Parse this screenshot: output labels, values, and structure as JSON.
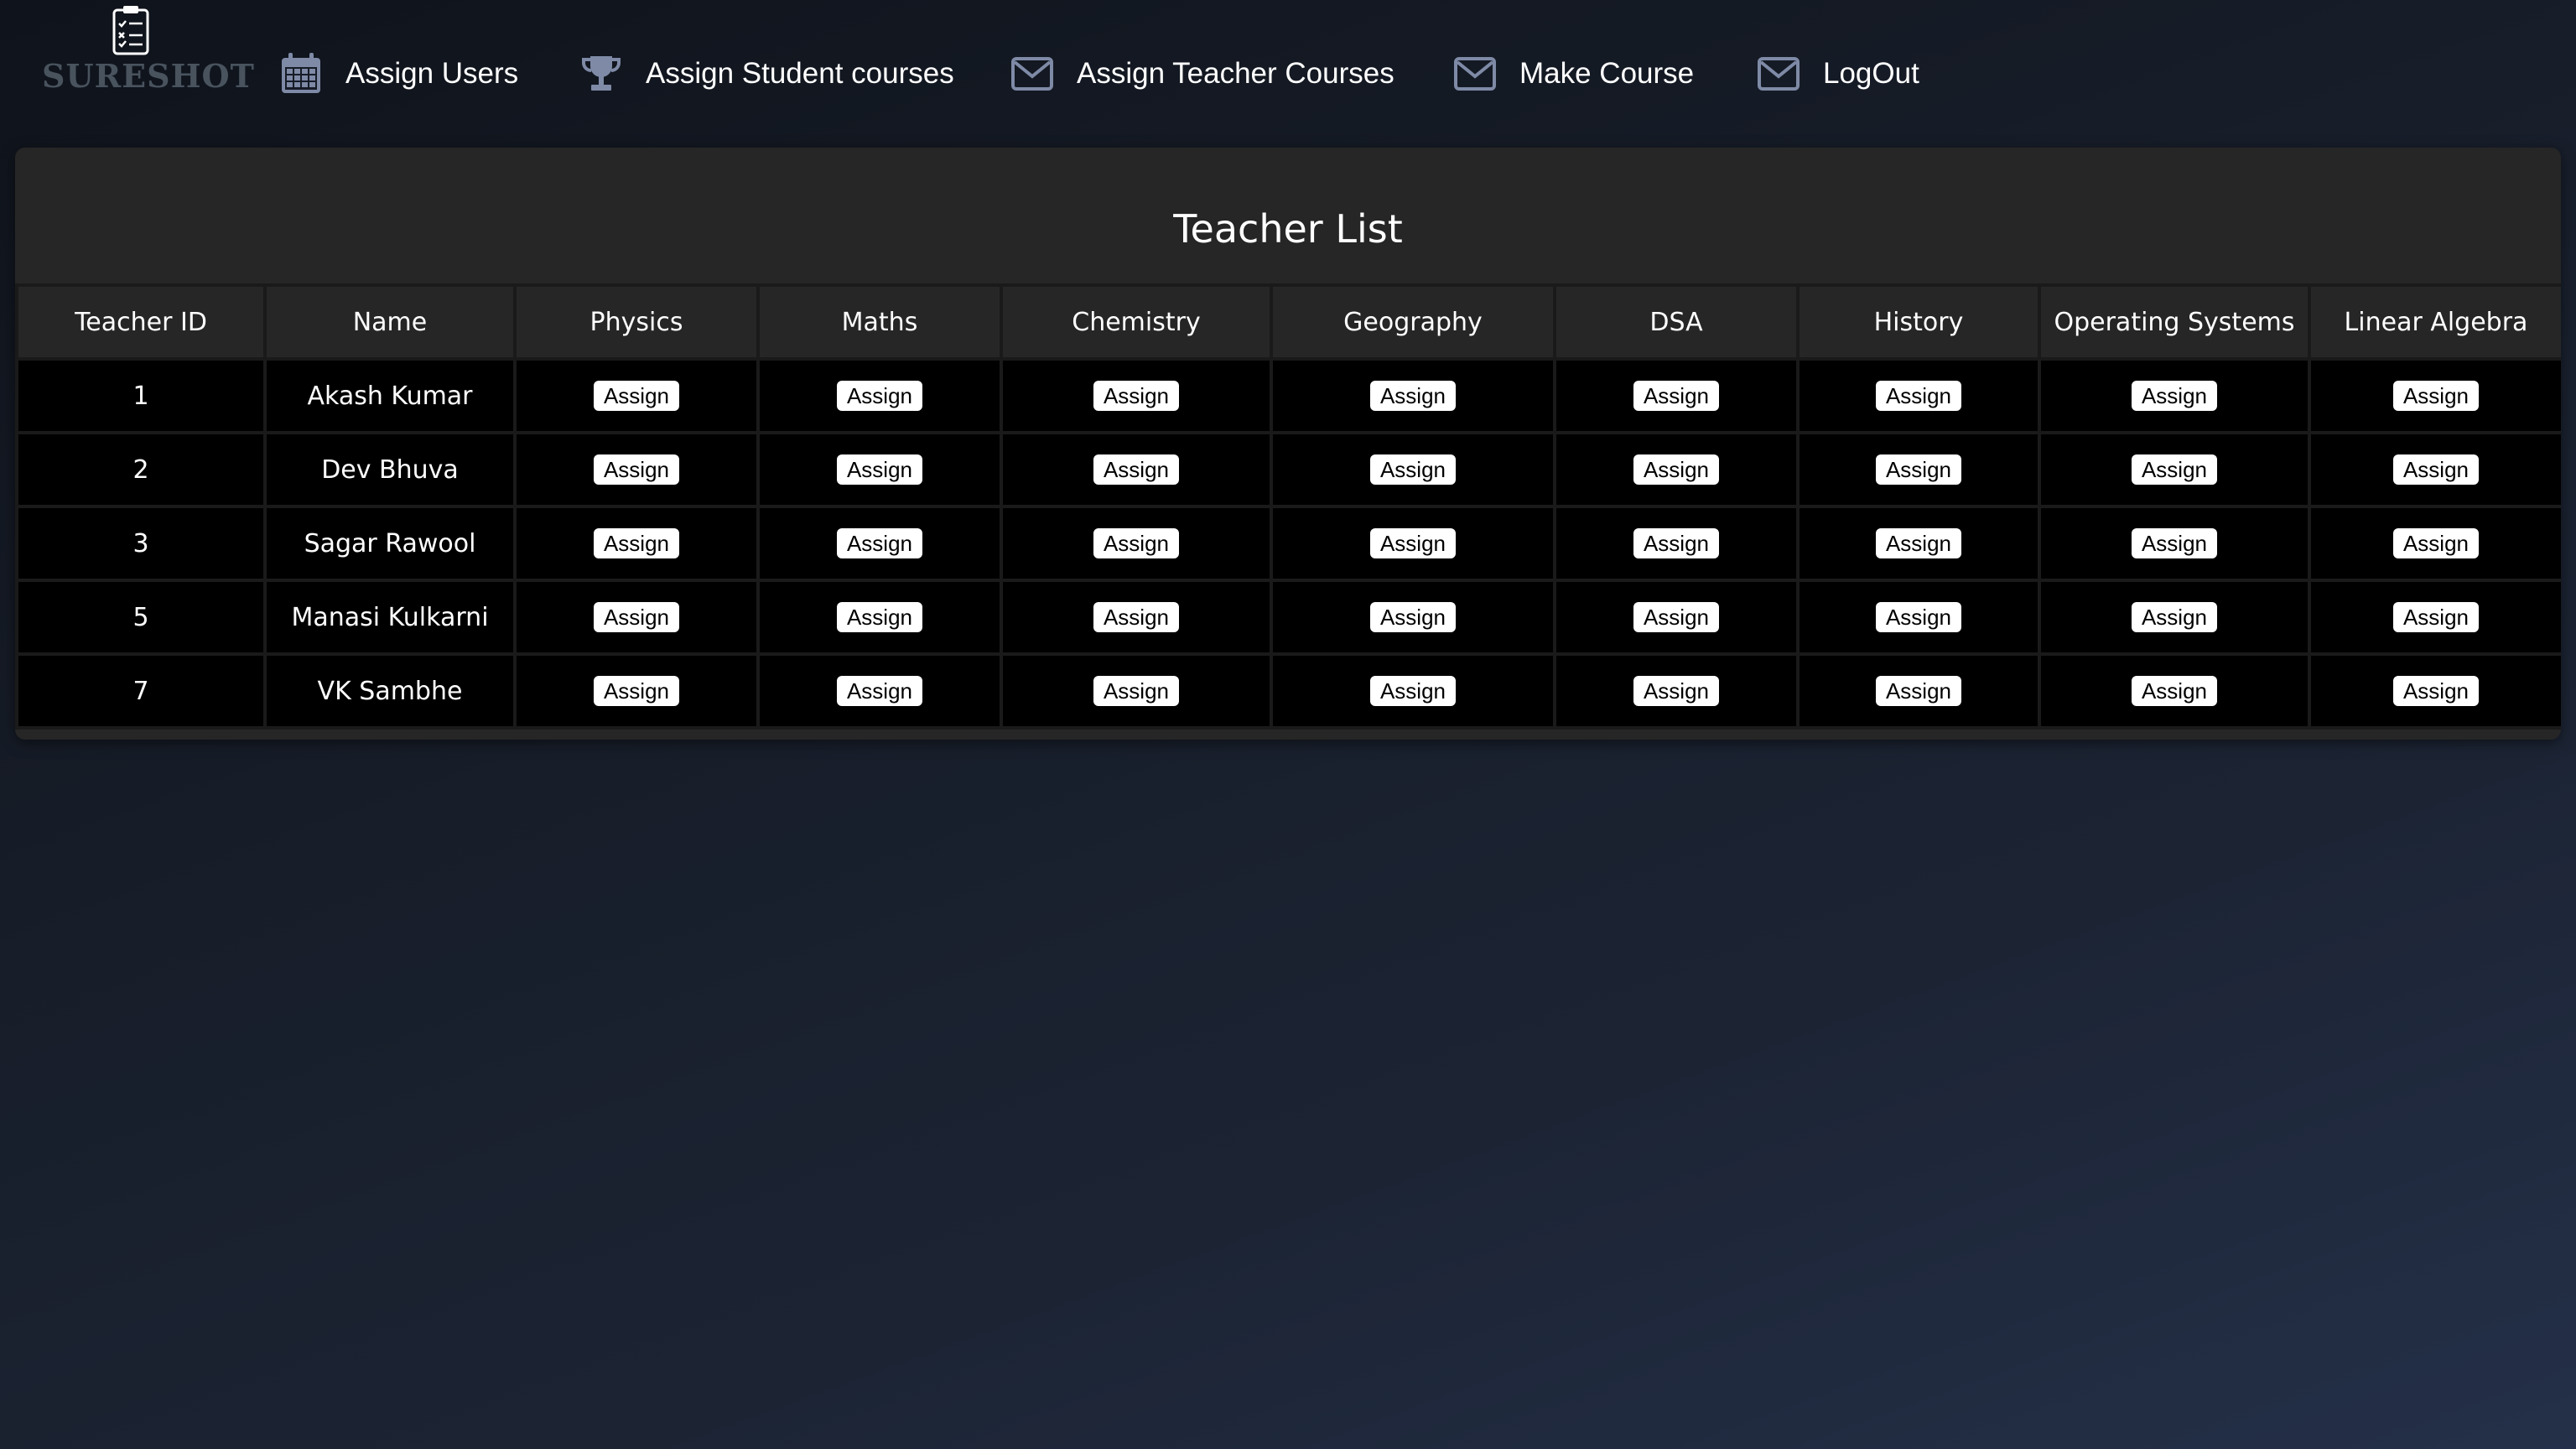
{
  "brand": {
    "name": "SURESHOT",
    "logo_icon": "clipboard-checklist-icon"
  },
  "nav": {
    "items": [
      {
        "label": "Assign Users",
        "icon": "calendar-icon"
      },
      {
        "label": "Assign Student courses",
        "icon": "trophy-icon"
      },
      {
        "label": "Assign Teacher Courses",
        "icon": "envelope-icon"
      },
      {
        "label": "Make Course",
        "icon": "envelope-icon"
      },
      {
        "label": "LogOut",
        "icon": "envelope-icon"
      }
    ]
  },
  "panel": {
    "title": "Teacher List"
  },
  "table": {
    "columns": [
      "Teacher ID",
      "Name",
      "Physics",
      "Maths",
      "Chemistry",
      "Geography",
      "DSA",
      "History",
      "Operating Systems",
      "Linear Algebra"
    ],
    "action_label": "Assign",
    "rows": [
      {
        "id": "1",
        "name": "Akash Kumar"
      },
      {
        "id": "2",
        "name": "Dev Bhuva"
      },
      {
        "id": "3",
        "name": "Sagar Rawool"
      },
      {
        "id": "5",
        "name": "Manasi Kulkarni"
      },
      {
        "id": "7",
        "name": "VK Sambhe"
      }
    ]
  },
  "colors": {
    "nav_icon": "#7e8aa6",
    "logo": "#48535e",
    "panel_bg": "#262626",
    "row_bg": "#000000",
    "button_bg": "#ffffff"
  }
}
